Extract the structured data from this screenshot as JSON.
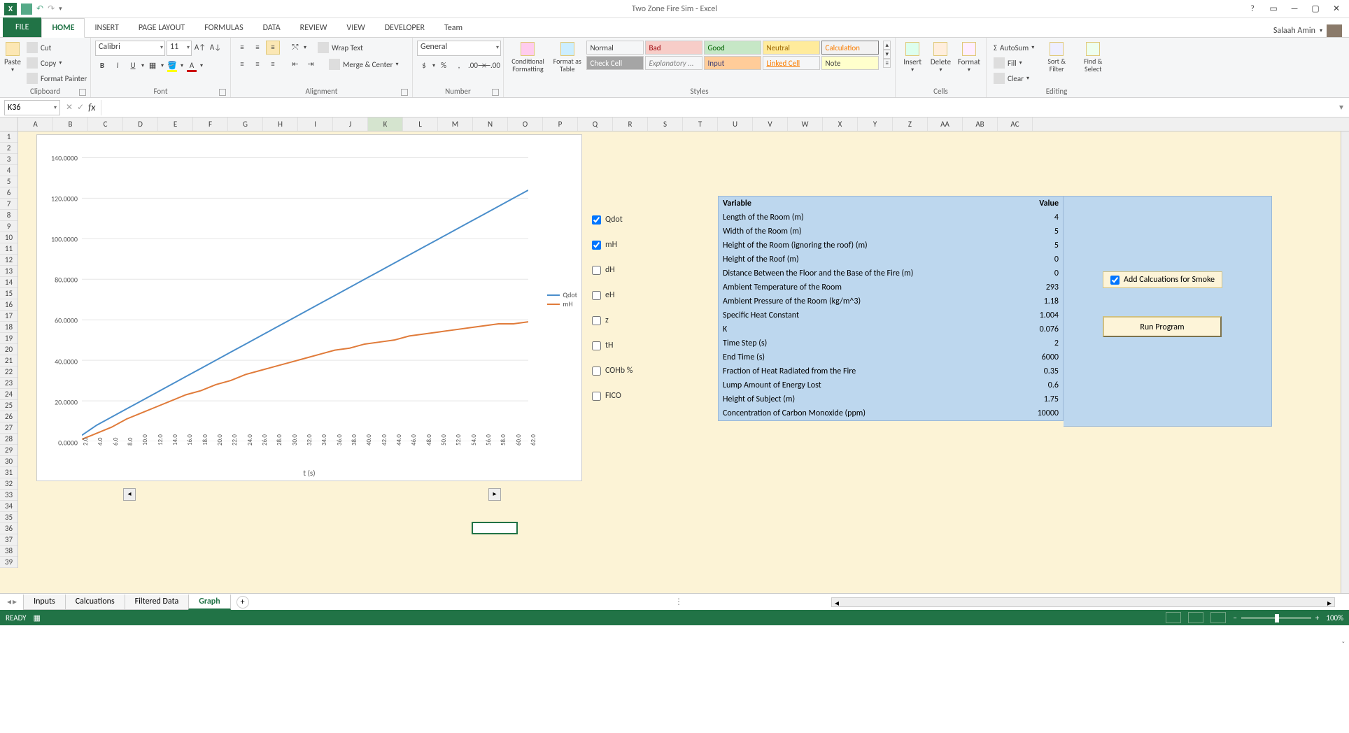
{
  "title": "Two Zone Fire Sim - Excel",
  "user_name": "Salaah Amin",
  "tabs": {
    "file": "FILE",
    "home": "HOME",
    "insert": "INSERT",
    "page_layout": "PAGE LAYOUT",
    "formulas": "FORMULAS",
    "data": "DATA",
    "review": "REVIEW",
    "view": "VIEW",
    "developer": "DEVELOPER",
    "team": "Team"
  },
  "ribbon": {
    "clipboard": {
      "label": "Clipboard",
      "paste": "Paste",
      "cut": "Cut",
      "copy": "Copy",
      "fp": "Format Painter"
    },
    "font": {
      "label": "Font",
      "name": "Calibri",
      "size": "11"
    },
    "alignment": {
      "label": "Alignment",
      "wrap": "Wrap Text",
      "merge": "Merge & Center"
    },
    "number": {
      "label": "Number",
      "format": "General"
    },
    "styles": {
      "label": "Styles",
      "cond": "Conditional Formatting",
      "fmtas": "Format as Table",
      "cells": [
        "Normal",
        "Bad",
        "Good",
        "Neutral",
        "Calculation",
        "Check Cell",
        "Explanatory ...",
        "Input",
        "Linked Cell",
        "Note"
      ]
    },
    "cells": {
      "label": "Cells",
      "insert": "Insert",
      "delete": "Delete",
      "format": "Format"
    },
    "editing": {
      "label": "Editing",
      "autosum": "AutoSum",
      "fill": "Fill",
      "clear": "Clear",
      "sort": "Sort & Filter",
      "find": "Find & Select"
    }
  },
  "namebox": "K36",
  "columns": [
    "A",
    "B",
    "C",
    "D",
    "E",
    "F",
    "G",
    "H",
    "I",
    "J",
    "K",
    "L",
    "M",
    "N",
    "O",
    "P",
    "Q",
    "R",
    "S",
    "T",
    "U",
    "V",
    "W",
    "X",
    "Y",
    "Z",
    "AA",
    "AB",
    "AC"
  ],
  "row_count": 39,
  "chart_data": {
    "type": "line",
    "x": [
      "2.0",
      "4.0",
      "6.0",
      "8.0",
      "10.0",
      "12.0",
      "14.0",
      "16.0",
      "18.0",
      "20.0",
      "22.0",
      "24.0",
      "26.0",
      "28.0",
      "30.0",
      "32.0",
      "34.0",
      "36.0",
      "38.0",
      "40.0",
      "42.0",
      "44.0",
      "46.0",
      "48.0",
      "50.0",
      "52.0",
      "54.0",
      "56.0",
      "58.0",
      "60.0",
      "62.0"
    ],
    "series": [
      {
        "name": "Qdot",
        "color": "#4a8ecb",
        "values": [
          3,
          8,
          12,
          16,
          20,
          24,
          28,
          32,
          36,
          40,
          44,
          48,
          52,
          56,
          60,
          64,
          68,
          72,
          76,
          80,
          84,
          88,
          92,
          96,
          100,
          104,
          108,
          112,
          116,
          120,
          124
        ]
      },
      {
        "name": "mH",
        "color": "#e07b3a",
        "values": [
          1,
          4,
          7,
          11,
          14,
          17,
          20,
          23,
          25,
          28,
          30,
          33,
          35,
          37,
          39,
          41,
          43,
          45,
          46,
          48,
          49,
          50,
          52,
          53,
          54,
          55,
          56,
          57,
          58,
          58,
          59
        ]
      }
    ],
    "y_ticks": [
      "0.0000",
      "20.0000",
      "40.0000",
      "60.0000",
      "80.0000",
      "100.0000",
      "120.0000",
      "140.0000"
    ],
    "ylim": [
      0,
      145
    ],
    "xlabel": "t (s)"
  },
  "checkboxes": [
    {
      "label": "Qdot",
      "checked": true
    },
    {
      "label": "mH",
      "checked": true
    },
    {
      "label": "dH",
      "checked": false
    },
    {
      "label": "eH",
      "checked": false
    },
    {
      "label": "z",
      "checked": false
    },
    {
      "label": "tH",
      "checked": false
    },
    {
      "label": "COHb %",
      "checked": false
    },
    {
      "label": "FICO",
      "checked": false
    }
  ],
  "vartable": {
    "headers": [
      "Variable",
      "Value"
    ],
    "rows": [
      [
        "Length of the Room (m)",
        "4"
      ],
      [
        "Width of the Room (m)",
        "5"
      ],
      [
        "Height of the Room (ignoring the roof) (m)",
        "5"
      ],
      [
        "Height of the Roof (m)",
        "0"
      ],
      [
        "Distance Between the Floor and the Base of the Fire (m)",
        "0"
      ],
      [
        "Ambient Temperature of the Room",
        "293"
      ],
      [
        "Ambient Pressure of the Room (kg/m^3)",
        "1.18"
      ],
      [
        "Specific Heat Constant",
        "1.004"
      ],
      [
        "K",
        "0.076"
      ],
      [
        "Time Step (s)",
        "2"
      ],
      [
        "End Time (s)",
        "6000"
      ],
      [
        "Fraction of Heat Radiated from the Fire",
        "0.35"
      ],
      [
        "Lump Amount of Energy Lost",
        "0.6"
      ],
      [
        "Height of Subject (m)",
        "1.75"
      ],
      [
        "Concentration of Carbon Monoxide (ppm)",
        "10000"
      ]
    ]
  },
  "controls": {
    "add_smoke": "Add Calcuations for Smoke",
    "add_smoke_checked": true,
    "run": "Run Program"
  },
  "sheets": [
    "Inputs",
    "Calcuations",
    "Filtered Data",
    "Graph"
  ],
  "active_sheet": "Graph",
  "status": {
    "ready": "READY",
    "zoom": "100%"
  }
}
